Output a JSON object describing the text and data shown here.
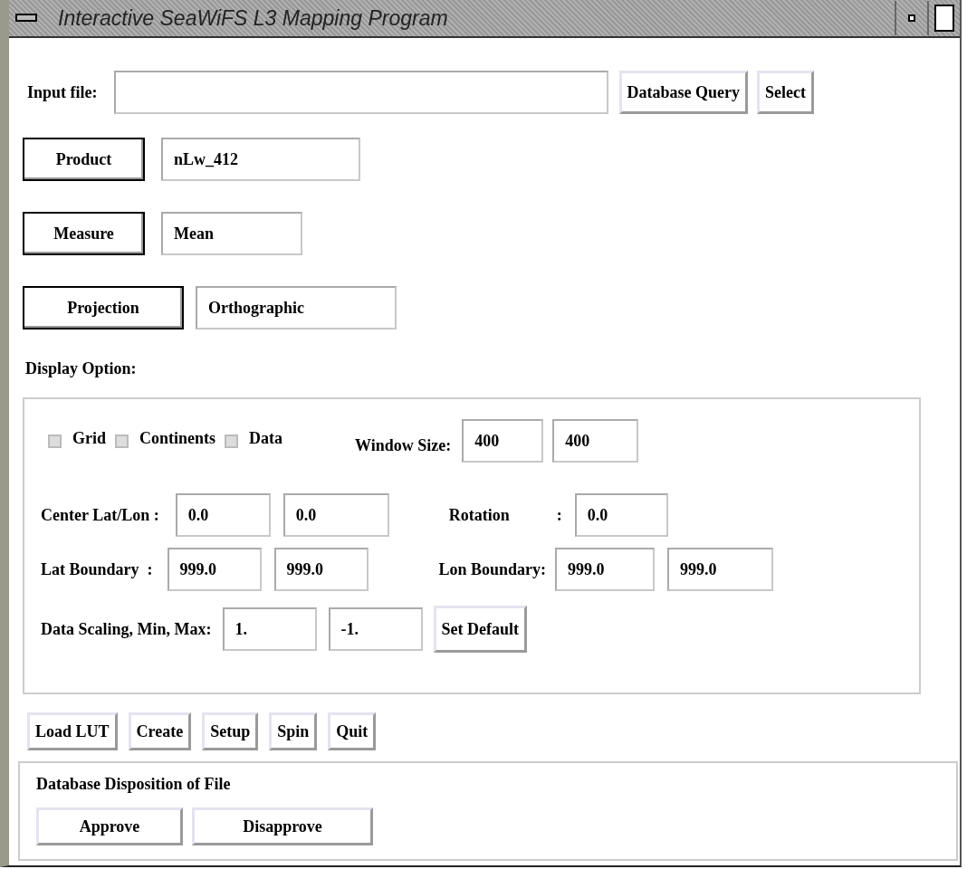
{
  "window": {
    "title": "Interactive SeaWiFS L3 Mapping Program"
  },
  "input_file": {
    "label": "Input file:",
    "buttons": [
      "Database Query",
      "Select"
    ]
  },
  "selectors": [
    {
      "button": "Product",
      "value": "nLw_412"
    },
    {
      "button": "Measure",
      "value": "Mean"
    },
    {
      "button": "Projection",
      "value": "Orthographic"
    }
  ],
  "display_option": {
    "label": "Display Option:",
    "checkboxes": [
      {
        "label": "Grid",
        "checked": false
      },
      {
        "label": "Continents",
        "checked": false
      },
      {
        "label": "Data",
        "checked": false
      }
    ],
    "window_size": {
      "label": "Window Size:",
      "values": [
        "400",
        "400"
      ]
    },
    "center": {
      "label": "Center Lat/Lon :",
      "values": [
        "0.0",
        "0.0"
      ]
    },
    "rotation": {
      "label": "Rotation",
      "separator": ":",
      "value": "0.0"
    },
    "lat_boundary": {
      "label": "Lat Boundary  :",
      "values": [
        "999.0",
        "999.0"
      ]
    },
    "lon_boundary": {
      "label": "Lon Boundary:",
      "values": [
        "999.0",
        "999.0"
      ]
    },
    "data_scaling": {
      "label": "Data Scaling, Min, Max:",
      "values": [
        "1.",
        "-1."
      ],
      "button": "Set Default"
    }
  },
  "actions": [
    "Load LUT",
    "Create",
    "Setup",
    "Spin",
    "Quit"
  ],
  "disposition": {
    "title": "Database Disposition of File",
    "buttons": [
      "Approve",
      "Disapprove"
    ]
  }
}
